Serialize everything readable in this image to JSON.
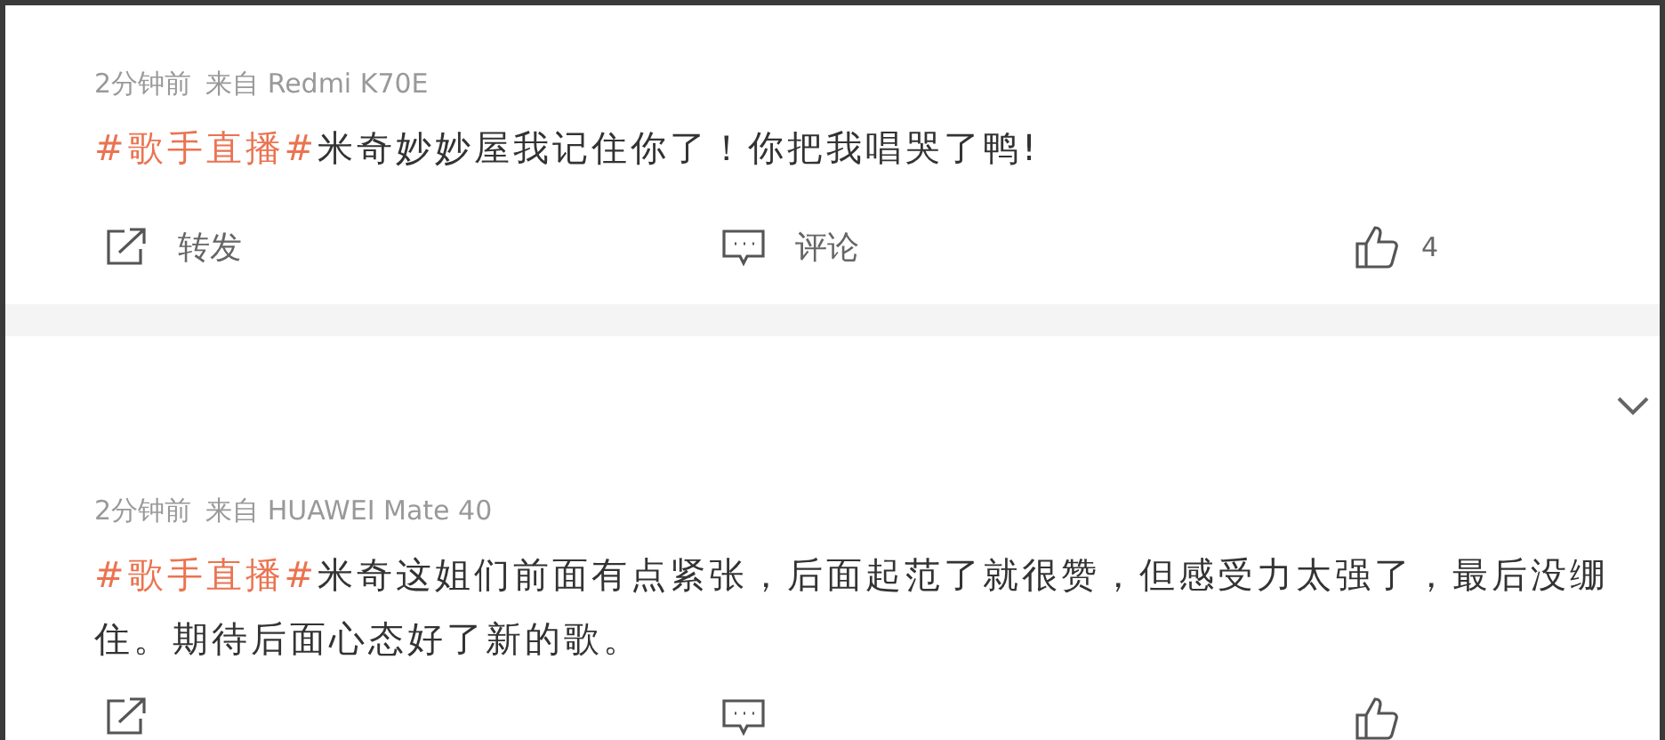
{
  "posts": [
    {
      "time": "2分钟前",
      "source": "来自 Redmi K70E",
      "hashtag": "#歌手直播#",
      "text": "米奇妙妙屋我记住你了！你把我唱哭了鸭!",
      "actions": [
        {
          "kind": "repost",
          "label": "转发"
        },
        {
          "kind": "comment",
          "label": "评论"
        },
        {
          "kind": "like",
          "label": "4"
        }
      ]
    },
    {
      "time": "2分钟前",
      "source": "来自 HUAWEI Mate 40",
      "hashtag": "#歌手直播#",
      "text": "米奇这姐们前面有点紧张，后面起范了就很赞，但感受力太强了，最后没绷住。期待后面心态好了新的歌。",
      "actions": [
        {
          "kind": "repost"
        },
        {
          "kind": "comment"
        },
        {
          "kind": "like"
        }
      ]
    }
  ]
}
